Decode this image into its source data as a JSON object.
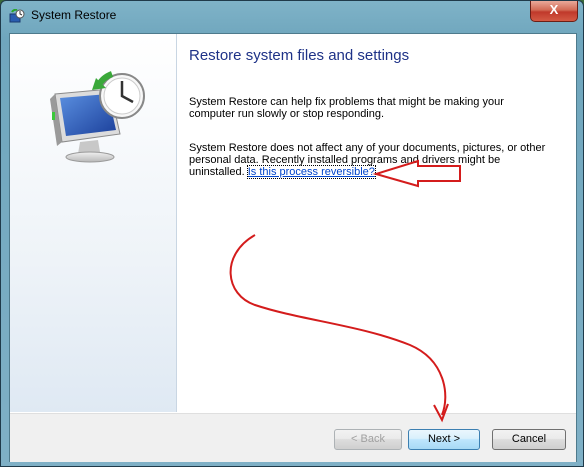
{
  "window": {
    "title": "System Restore",
    "close_label": "X"
  },
  "main": {
    "heading": "Restore system files and settings",
    "paragraph1": "System Restore can help fix problems that might be making your computer run slowly or stop responding.",
    "paragraph2": "System Restore does not affect any of your documents, pictures, or other personal data. Recently installed programs and drivers might be uninstalled.",
    "link_text": "Is this process reversible?"
  },
  "buttons": {
    "back": "< Back",
    "next": "Next >",
    "cancel": "Cancel"
  },
  "colors": {
    "heading": "#1e3287",
    "link": "#0044cc",
    "annotation": "#d41c1c"
  },
  "icons": {
    "app": "system-restore-icon",
    "illustration": "monitor-with-clock-arrow"
  }
}
